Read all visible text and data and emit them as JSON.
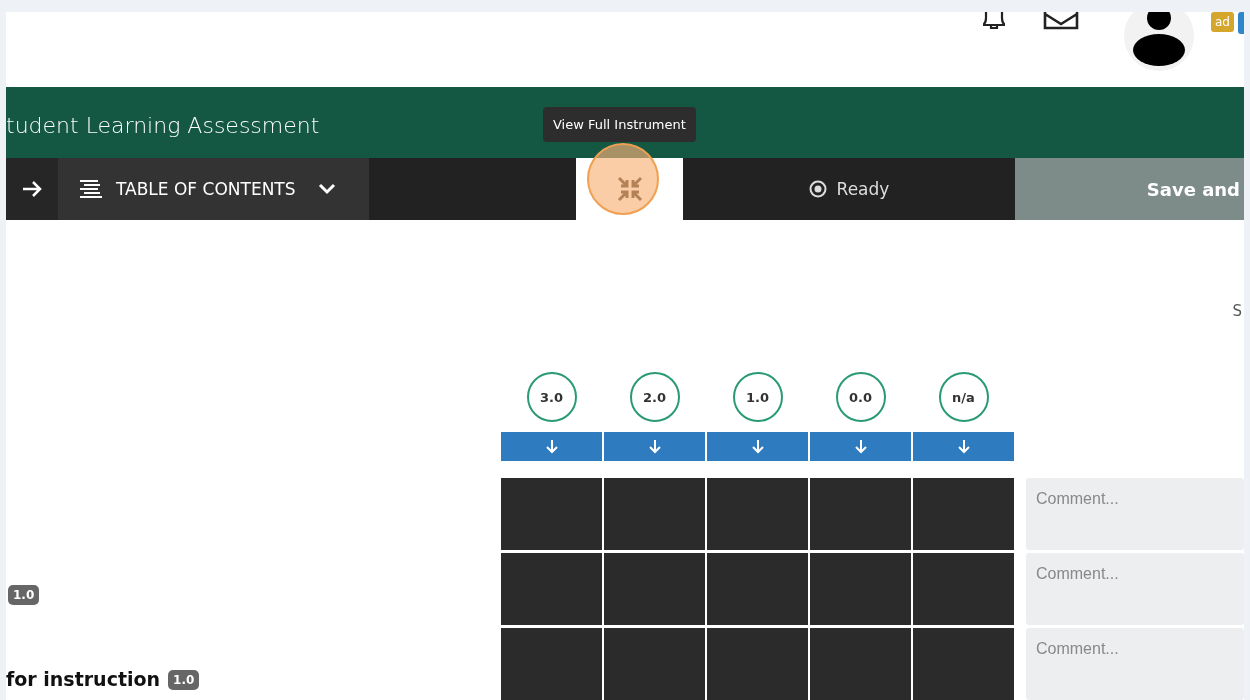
{
  "header": {
    "badge": "ad"
  },
  "title": "tudent Learning Assessment",
  "toolbar": {
    "toc_label": "TABLE OF CONTENTS",
    "tooltip": "View Full Instrument",
    "status": "Ready",
    "save_label": "Save and"
  },
  "side_text": "S",
  "scale": [
    {
      "label": "3.0"
    },
    {
      "label": "2.0"
    },
    {
      "label": "1.0"
    },
    {
      "label": "0.0"
    },
    {
      "label": "n/a"
    }
  ],
  "rows": [
    {
      "comment_placeholder": "Comment..."
    },
    {
      "score": "1.0",
      "comment_placeholder": "Comment..."
    },
    {
      "label": "for instruction",
      "score": "1.0",
      "comment_placeholder": "Comment..."
    }
  ]
}
